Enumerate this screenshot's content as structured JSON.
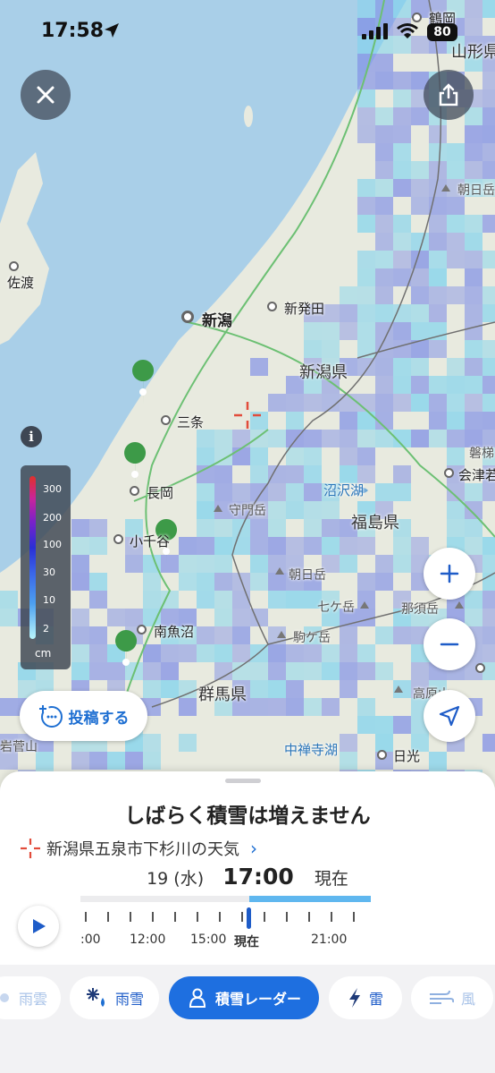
{
  "status_bar": {
    "time": "17:58",
    "battery": "80"
  },
  "map": {
    "places": [
      {
        "key": "tsuruoka",
        "name": "鶴岡"
      },
      {
        "key": "yamagata",
        "name": "山形県"
      },
      {
        "key": "asahi",
        "name": "朝日岳"
      },
      {
        "key": "sado",
        "name": "佐渡"
      },
      {
        "key": "niigata",
        "name": "新潟"
      },
      {
        "key": "shibata",
        "name": "新発田"
      },
      {
        "key": "niigata_pref",
        "name": "新潟県"
      },
      {
        "key": "sanjo",
        "name": "三条"
      },
      {
        "key": "nagaoka",
        "name": "長岡"
      },
      {
        "key": "ojiya",
        "name": "小千谷"
      },
      {
        "key": "minamiuonuma",
        "name": "南魚沼"
      },
      {
        "key": "gunma_pref",
        "name": "群馬県"
      },
      {
        "key": "fukushima_pref",
        "name": "福島県"
      },
      {
        "key": "okuzawa",
        "name": "守門岳"
      },
      {
        "key": "numazawa",
        "name": "沼沢湖"
      },
      {
        "key": "aizuwakamatsu",
        "name": "会津若"
      },
      {
        "key": "bandai",
        "name": "磐梯"
      },
      {
        "key": "asahi2",
        "name": "朝日岳"
      },
      {
        "key": "nanatsuga",
        "name": "七ケ岳"
      },
      {
        "key": "nasu",
        "name": "那須岳"
      },
      {
        "key": "komaga",
        "name": "駒ケ岳"
      },
      {
        "key": "takahara",
        "name": "高原山"
      },
      {
        "key": "chuzenji",
        "name": "中禅寺湖"
      },
      {
        "key": "nikko",
        "name": "日光"
      },
      {
        "key": "iwasuge",
        "name": "岩菅山"
      }
    ],
    "legend": {
      "levels": [
        "300",
        "200",
        "100",
        "30",
        "10",
        "2"
      ],
      "unit": "cm"
    },
    "info_label": "i",
    "post_button": "投稿する"
  },
  "panel": {
    "headline": "しばらく積雪は増えません",
    "location": "新潟県五泉市下杉川の天気",
    "date": "19 (水)",
    "time": "17:00",
    "now_label": "現在",
    "timeline": {
      "labels": [
        ":00",
        "12:00",
        "15:00",
        "現在",
        "21:00"
      ],
      "progress_fraction": 0.58
    }
  },
  "tabs": [
    {
      "key": "rain_cloud",
      "label": "雨雲",
      "icon": "cloud-icon"
    },
    {
      "key": "rain_snow",
      "label": "雨雪",
      "icon": "snow-rain-icon"
    },
    {
      "key": "snow_radar",
      "label": "積雪レーダー",
      "icon": "snowman-icon",
      "active": true
    },
    {
      "key": "thunder",
      "label": "雷",
      "icon": "lightning-icon"
    },
    {
      "key": "wind",
      "label": "風",
      "icon": "wind-icon"
    }
  ],
  "colors": {
    "accent": "#1e6fe0",
    "sea": "#a9cfe8",
    "land": "#e9ebe2",
    "snow_light": "#7fd3ee",
    "snow_mid": "#7f8fe6"
  }
}
